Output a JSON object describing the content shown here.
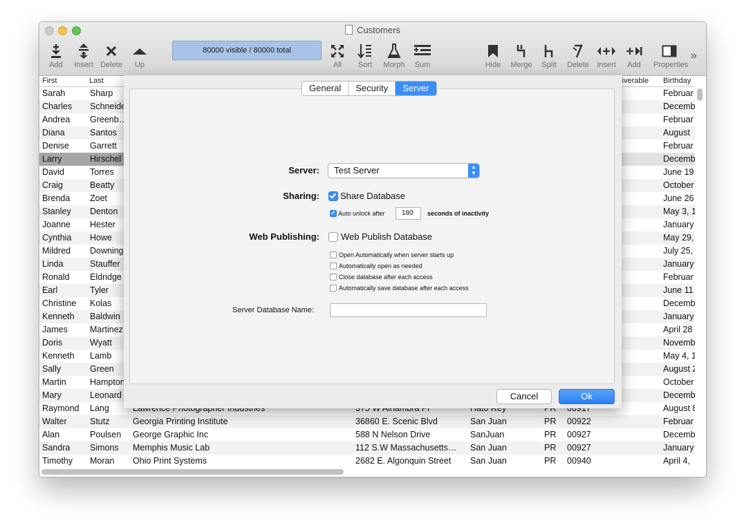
{
  "window": {
    "title": "Customers"
  },
  "toolbar": {
    "left": [
      {
        "label": "Add",
        "icon": "add-row-icon"
      },
      {
        "label": "Insert",
        "icon": "insert-row-icon"
      },
      {
        "label": "Delete",
        "icon": "delete-x-icon"
      },
      {
        "label": "Up",
        "icon": "up-arrow-icon"
      }
    ],
    "counter": "80000 visible / 80000 total",
    "middle": [
      {
        "label": "All",
        "icon": "expand-all-icon"
      },
      {
        "label": "Sort",
        "icon": "sort-icon"
      },
      {
        "label": "Morph",
        "icon": "flask-icon"
      },
      {
        "label": "Sum",
        "icon": "sum-icon"
      }
    ],
    "right": [
      {
        "label": "Hide",
        "icon": "bookmark-icon"
      },
      {
        "label": "Merge",
        "icon": "merge-icon"
      },
      {
        "label": "Split",
        "icon": "split-icon"
      },
      {
        "label": "Delete",
        "icon": "delete-column-icon"
      },
      {
        "label": "Insert",
        "icon": "insert-column-icon"
      },
      {
        "label": "Add",
        "icon": "add-column-icon"
      },
      {
        "label": "Properties",
        "icon": "properties-icon"
      }
    ],
    "more": "»"
  },
  "columns": {
    "first": "First",
    "last": "Last",
    "deliverable": "eliverable",
    "birthday": "Birthday"
  },
  "rows": [
    {
      "first": "Sarah",
      "last": "Sharp",
      "birthday": "Februar"
    },
    {
      "first": "Charles",
      "last": "Schneide",
      "birthday": "Decemb"
    },
    {
      "first": "Andrea",
      "last": "Greenb…",
      "birthday": "Februar"
    },
    {
      "first": "Diana",
      "last": "Santos",
      "birthday": "August"
    },
    {
      "first": "Denise",
      "last": "Garrett",
      "birthday": "Februar"
    },
    {
      "first": "Larry",
      "last": "Hirschel",
      "birthday": "Decemb"
    },
    {
      "first": "David",
      "last": "Torres",
      "birthday": "June 19"
    },
    {
      "first": "Craig",
      "last": "Beatty",
      "birthday": "October"
    },
    {
      "first": "Brenda",
      "last": "Zoet",
      "birthday": "June 26"
    },
    {
      "first": "Stanley",
      "last": "Denton",
      "birthday": "May 3, 1"
    },
    {
      "first": "Joanne",
      "last": "Hester",
      "birthday": "January"
    },
    {
      "first": "Cynthia",
      "last": "Howe",
      "birthday": "May 29,"
    },
    {
      "first": "Mildred",
      "last": "Downing",
      "birthday": "July 25,"
    },
    {
      "first": "Linda",
      "last": "Stauffer",
      "birthday": "January"
    },
    {
      "first": "Ronald",
      "last": "Eldridge",
      "birthday": "Februar"
    },
    {
      "first": "Earl",
      "last": "Tyler",
      "birthday": "June 11"
    },
    {
      "first": "Christine",
      "last": "Kolas",
      "birthday": "Decemb"
    },
    {
      "first": "Kenneth",
      "last": "Baldwin",
      "birthday": "January"
    },
    {
      "first": "James",
      "last": "Martinez",
      "birthday": "April 28"
    },
    {
      "first": "Doris",
      "last": "Wyatt",
      "birthday": "Novemb"
    },
    {
      "first": "Kenneth",
      "last": "Lamb",
      "birthday": "May 4, 1"
    },
    {
      "first": "Sally",
      "last": "Green",
      "birthday": "August 2"
    },
    {
      "first": "Martin",
      "last": "Hampton",
      "birthday": "October"
    },
    {
      "first": "Mary",
      "last": "Leonard",
      "birthday": "Decemb"
    },
    {
      "first": "Raymond",
      "last": "Lang",
      "company": "Lawrence Photographer Industries",
      "address": "375 W Alhambra Pl",
      "city": "Hato Rey",
      "state": "PR",
      "zip": "00917",
      "birthday": "August 8"
    },
    {
      "first": "Walter",
      "last": "Stutz",
      "company": "Georgia Printing Institute",
      "address": "36860 E. Scenic Blvd",
      "city": "San Juan",
      "state": "PR",
      "zip": "00922",
      "birthday": "Februar"
    },
    {
      "first": "Alan",
      "last": "Poulsen",
      "company": "George Graphic Inc",
      "address": "588 N Nelson Drive",
      "city": "SanJuan",
      "state": "PR",
      "zip": "00927",
      "birthday": "Decemb"
    },
    {
      "first": "Sandra",
      "last": "Simons",
      "company": "Memphis Music Lab",
      "address": "112 S.W Massachusetts…",
      "city": "San Juan",
      "state": "PR",
      "zip": "00927",
      "birthday": "January"
    },
    {
      "first": "Timothy",
      "last": "Moran",
      "company": "Ohio Print Systems",
      "address": "2682 E. Algonquin Street",
      "city": "San Juan",
      "state": "PR",
      "zip": "00940",
      "birthday": "April 4,"
    }
  ],
  "dialog": {
    "tabs": [
      {
        "label": "General",
        "active": false
      },
      {
        "label": "Security",
        "active": false
      },
      {
        "label": "Server",
        "active": true
      }
    ],
    "server_label": "Server:",
    "server_value": "Test Server",
    "sharing_label": "Sharing:",
    "share_database": "Share Database",
    "auto_unlock": "Auto unlock after",
    "auto_unlock_value": "180",
    "seconds_label": "seconds of inactivity",
    "web_publishing_label": "Web Publishing:",
    "web_publish_database": "Web Publish Database",
    "web_options": [
      "Open Automatically when server starts up",
      "Automatically open as needed",
      "Close database after each access",
      "Automatically save database after each access"
    ],
    "server_db_name_label": "Server Database Name:",
    "server_db_name_value": "",
    "cancel": "Cancel",
    "ok": "Ok"
  },
  "colors": {
    "accent": "#3c8ef5",
    "counter_bg": "#a9c3e8"
  }
}
